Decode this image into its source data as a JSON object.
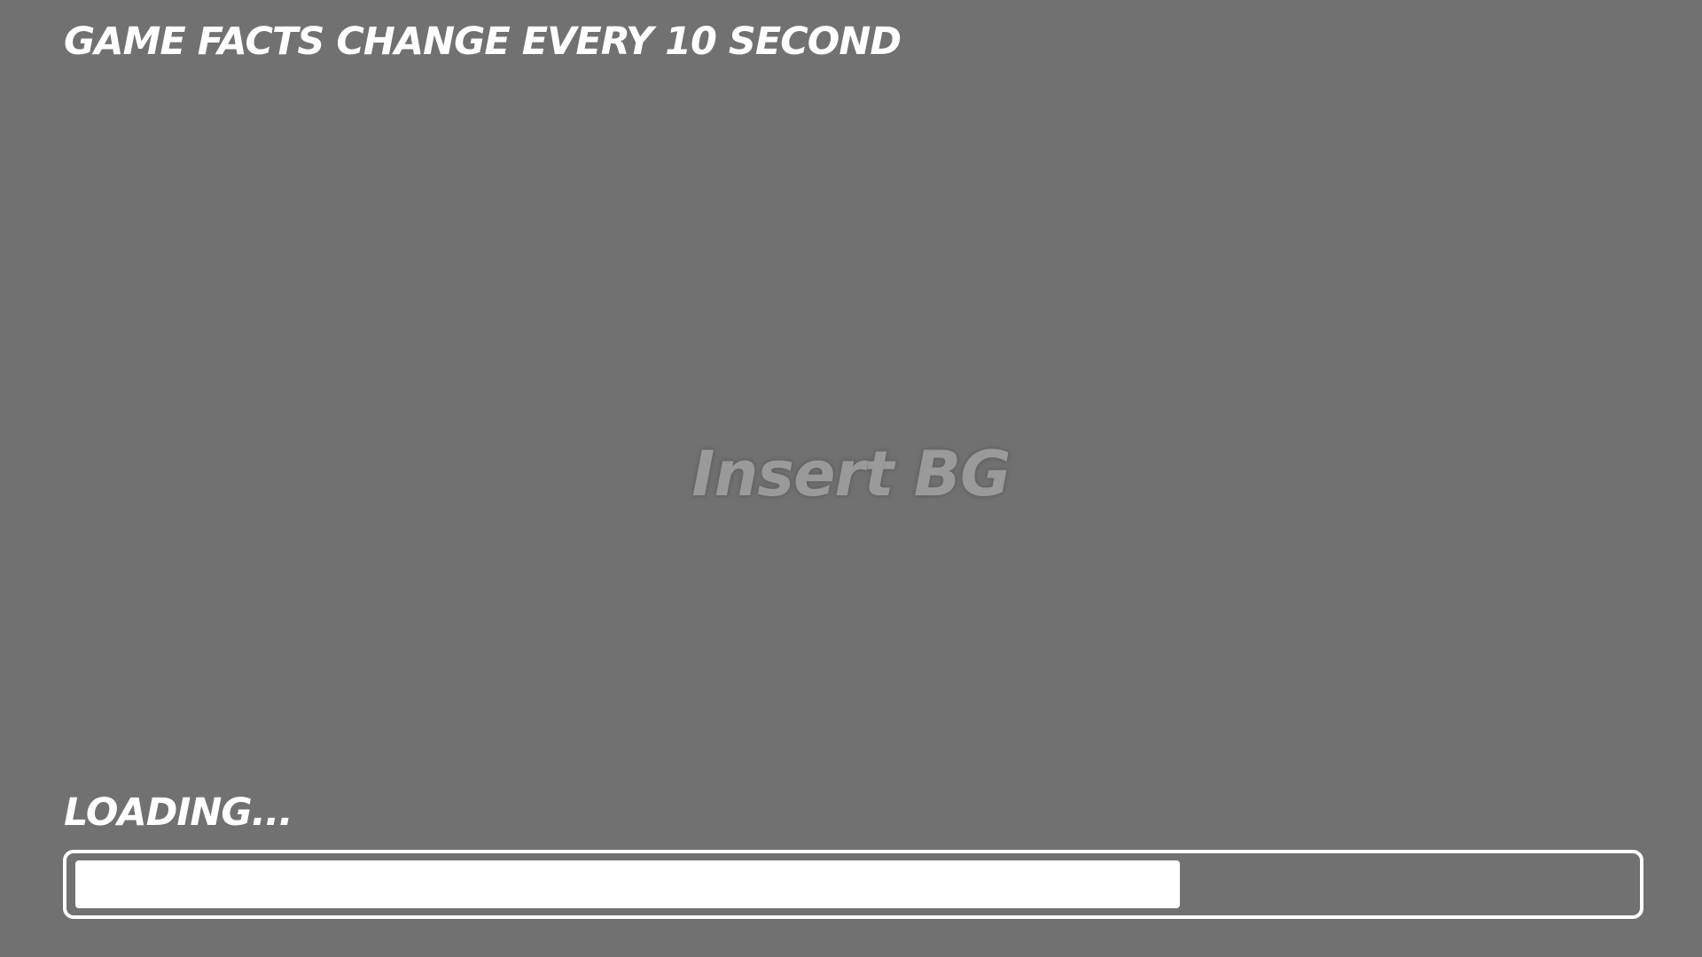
{
  "header": {
    "fact_text": "GAME FACTS CHANGE EVERY 10 SECOND"
  },
  "background": {
    "placeholder_text": "Insert BG"
  },
  "loading": {
    "label": "LOADING...",
    "progress_fraction": 0.71
  },
  "colors": {
    "background": "#717171",
    "text": "#ffffff",
    "placeholder_text": "#9a9a9a",
    "progress_fill": "#ffffff"
  }
}
